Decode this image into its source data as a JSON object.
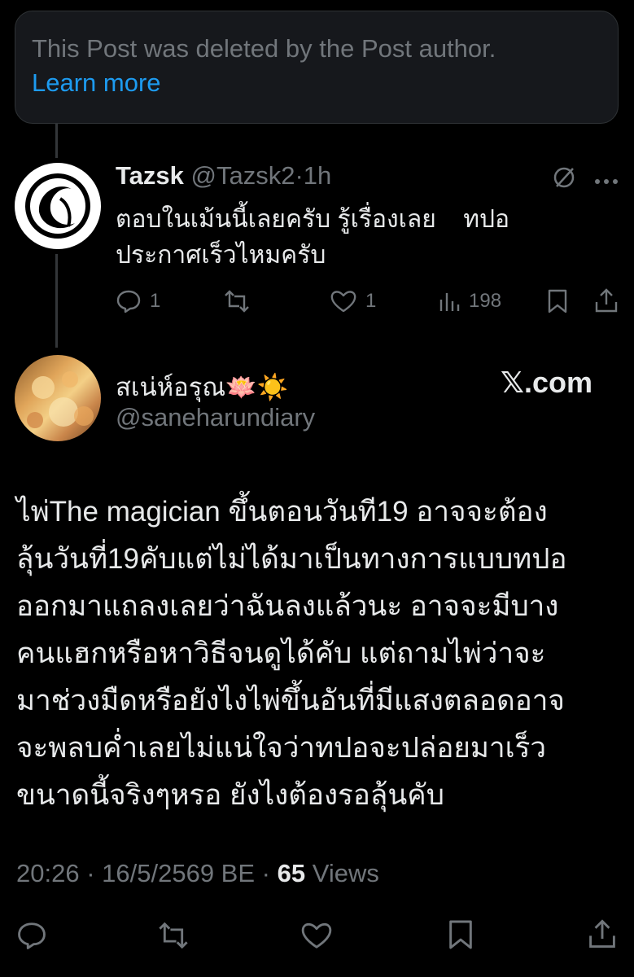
{
  "notice": {
    "text": "This Post was deleted by the Post author.",
    "link": "Learn more"
  },
  "reply": {
    "name": "Tazsk",
    "handle": "@Tazsk2",
    "separator": "·",
    "time": "1h",
    "line1": "ตอบในเม้นนี้เลยครับ รู้เรื่องเลย    ทปอ",
    "line2": "ประกาศเร็วไหมครับ",
    "replies": "1",
    "likes": "1",
    "views": "198",
    "icons": [
      "mute-icon",
      "more-icon",
      "reply-icon",
      "repost-icon",
      "like-icon",
      "views-icon",
      "bookmark-icon",
      "share-icon"
    ]
  },
  "quote": {
    "name": "สเน่ห์อรุณ🪷☀️",
    "handle": "@saneharundiary",
    "site": "𝕏.com"
  },
  "post": {
    "lines": [
      "ไพ่The magician ขึ้นตอนวันที19 อาจจะต้อง",
      "ลุ้นวันที่19คับแต่ไม่ได้มาเป็นทางการแบบทปอ",
      "ออกมาแถลงเลยว่าฉันลงแล้วนะ อาจจะมีบาง",
      "คนแฮกหรือหาวิธีจนดูได้คับ แต่ถามไพ่ว่าจะ",
      "มาช่วงมืดหรือยังไงไพ่ขึ้นอันที่มีแสงตลอดอาจ",
      "จะพลบค่ำเลยไม่แน่ใจว่าทปอจะปล่อยมาเร็ว",
      "ขนาดนี้จริงๆหรอ ยังไงต้องรอลุ้นคับ"
    ]
  },
  "meta": {
    "time": "20:26",
    "sep1": "·",
    "date": "16/5/2569 BE",
    "sep2": "·",
    "views_count": "65",
    "views_label": "Views"
  },
  "colors": {
    "background": "#000000",
    "text": "#e7e9ea",
    "secondary": "#71767b",
    "link": "#1d9bf0",
    "card": "#16181c"
  }
}
